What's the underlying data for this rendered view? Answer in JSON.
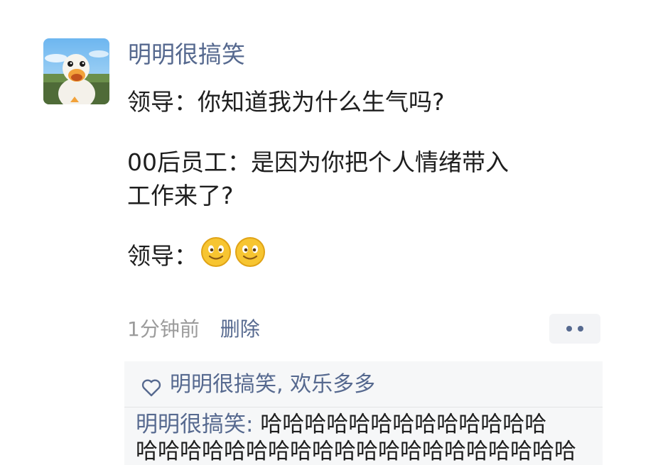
{
  "post": {
    "author": "明明很搞笑",
    "lines": [
      "领导：你知道我为什么生气吗?",
      "00后员工：是因为你把个人情绪带入",
      "工作来了?",
      "领导："
    ],
    "reaction_emojis": [
      "smiling-face-emoji",
      "smiling-face-emoji"
    ],
    "time": "1分钟前",
    "delete_label": "删除",
    "more_icon": "more-dots-icon"
  },
  "interactions": {
    "likes_icon": "heart-icon",
    "likes_text": "明明很搞笑, 欢乐多多",
    "comment": {
      "author": "明明很搞笑:",
      "text_line1": " 哈哈哈哈哈哈哈哈哈哈哈哈哈",
      "text_line2": "哈哈哈哈哈哈哈哈哈哈哈哈哈哈哈哈哈哈哈哈"
    }
  },
  "colors": {
    "link_blue": "#56698f",
    "time_gray": "#9b9b9b",
    "panel_bg": "#f6f7f8",
    "text": "#1e1e1e"
  }
}
